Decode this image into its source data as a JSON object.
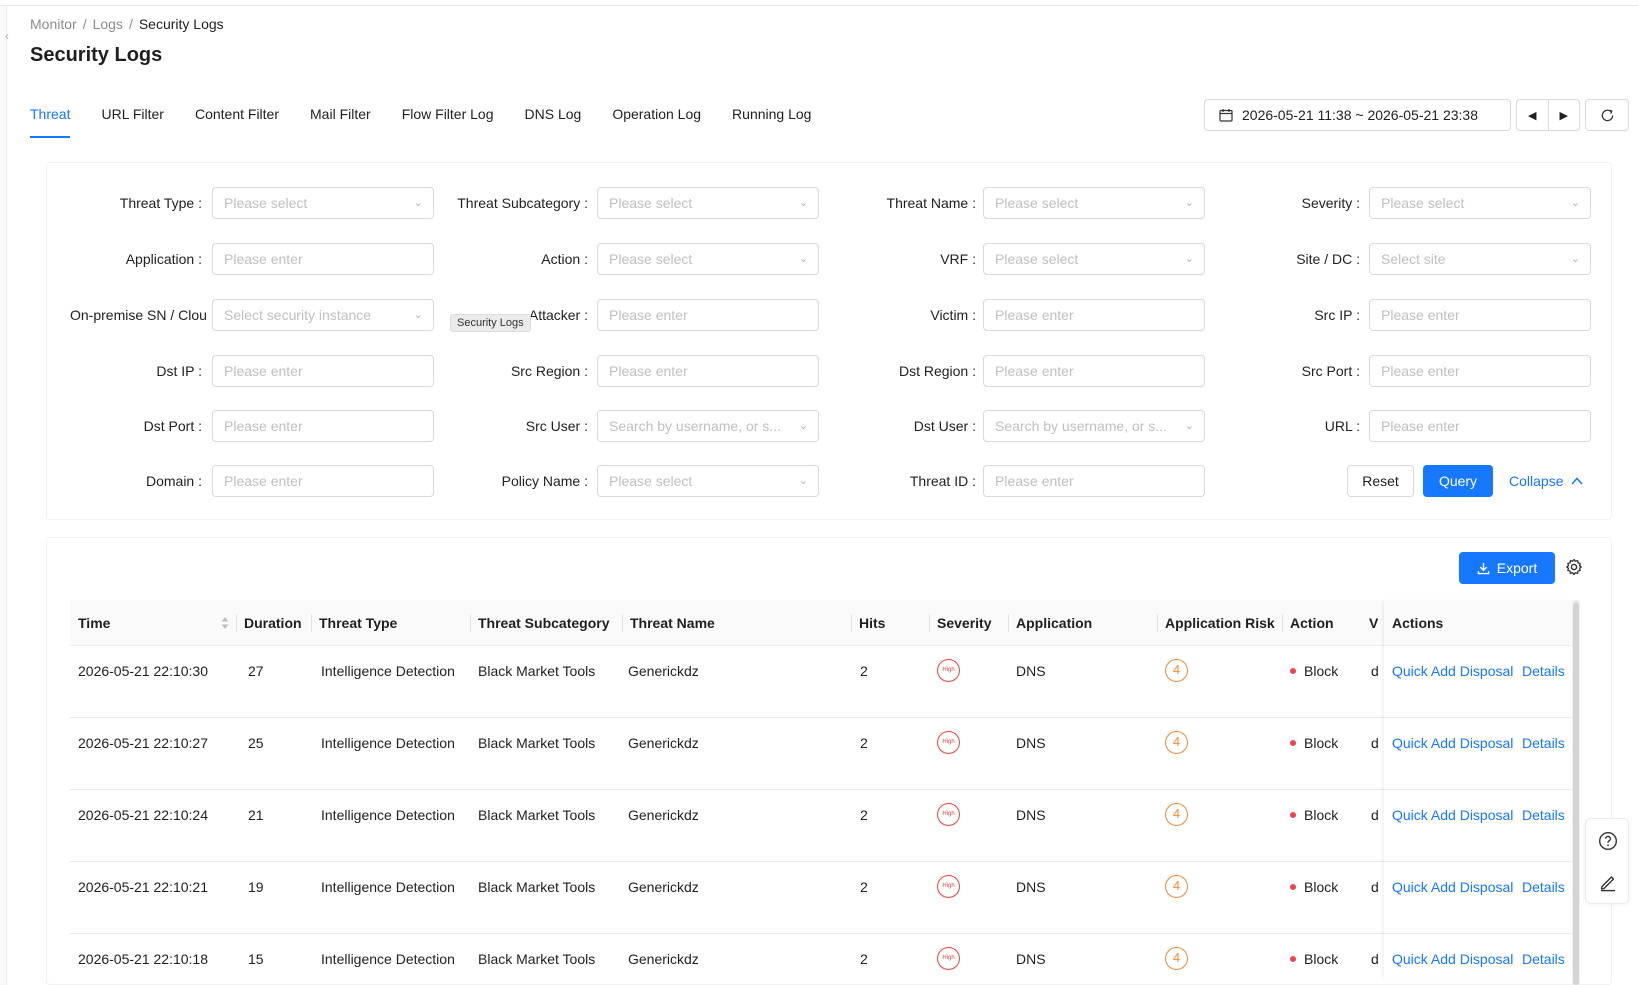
{
  "breadcrumb": [
    "Monitor",
    "Logs",
    "Security Logs"
  ],
  "page_title": "Security Logs",
  "tabs": [
    "Threat",
    "URL Filter",
    "Content Filter",
    "Mail Filter",
    "Flow Filter Log",
    "DNS Log",
    "Operation Log",
    "Running Log"
  ],
  "active_tab": "Threat",
  "date_range": "2026-05-21 11:38 ~ 2026-05-21 23:38",
  "tooltip": "Security Logs",
  "filters": [
    {
      "label": "Threat Type",
      "placeholder": "Please select",
      "kind": "select"
    },
    {
      "label": "Threat Subcategory",
      "placeholder": "Please select",
      "kind": "select"
    },
    {
      "label": "Threat Name",
      "placeholder": "Please select",
      "kind": "select"
    },
    {
      "label": "Severity",
      "placeholder": "Please select",
      "kind": "select"
    },
    {
      "label": "Application",
      "placeholder": "Please enter",
      "kind": "input"
    },
    {
      "label": "Action",
      "placeholder": "Please select",
      "kind": "select"
    },
    {
      "label": "VRF",
      "placeholder": "Please select",
      "kind": "select"
    },
    {
      "label": "Site / DC",
      "placeholder": "Select site",
      "kind": "select"
    },
    {
      "label": "On-premise SN / Clou",
      "placeholder": "Select security instance",
      "kind": "select"
    },
    {
      "label": "Attacker",
      "placeholder": "Please enter",
      "kind": "input"
    },
    {
      "label": "Victim",
      "placeholder": "Please enter",
      "kind": "input"
    },
    {
      "label": "Src IP",
      "placeholder": "Please enter",
      "kind": "input"
    },
    {
      "label": "Dst IP",
      "placeholder": "Please enter",
      "kind": "input"
    },
    {
      "label": "Src Region",
      "placeholder": "Please enter",
      "kind": "input"
    },
    {
      "label": "Dst Region",
      "placeholder": "Please enter",
      "kind": "input"
    },
    {
      "label": "Src Port",
      "placeholder": "Please enter",
      "kind": "input"
    },
    {
      "label": "Dst Port",
      "placeholder": "Please enter",
      "kind": "input"
    },
    {
      "label": "Src User",
      "placeholder": "Search by username, or s...",
      "kind": "select"
    },
    {
      "label": "Dst User",
      "placeholder": "Search by username, or s...",
      "kind": "select"
    },
    {
      "label": "URL",
      "placeholder": "Please enter",
      "kind": "input"
    },
    {
      "label": "Domain",
      "placeholder": "Please enter",
      "kind": "input"
    },
    {
      "label": "Policy Name",
      "placeholder": "Please select",
      "kind": "select"
    },
    {
      "label": "Threat ID",
      "placeholder": "Please enter",
      "kind": "input"
    }
  ],
  "buttons": {
    "reset": "Reset",
    "query": "Query",
    "collapse": "Collapse",
    "export": "Export"
  },
  "table": {
    "columns": [
      "Time",
      "Duration",
      "Threat Type",
      "Threat Subcategory",
      "Threat Name",
      "Hits",
      "Severity",
      "Application",
      "Application Risk",
      "Action",
      "V",
      "Actions"
    ],
    "rows": [
      {
        "time": "2026-05-21 22:10:30",
        "duration": "27",
        "threat_type": "Intelligence Detection",
        "subcategory": "Black Market Tools",
        "threat_name": "Generickdz",
        "hits": "2",
        "severity": "High",
        "application": "DNS",
        "app_risk": "4",
        "action": "Block",
        "v": "d",
        "quick_add": "Quick Add Disposal",
        "details": "Details"
      },
      {
        "time": "2026-05-21 22:10:27",
        "duration": "25",
        "threat_type": "Intelligence Detection",
        "subcategory": "Black Market Tools",
        "threat_name": "Generickdz",
        "hits": "2",
        "severity": "High",
        "application": "DNS",
        "app_risk": "4",
        "action": "Block",
        "v": "d",
        "quick_add": "Quick Add Disposal",
        "details": "Details"
      },
      {
        "time": "2026-05-21 22:10:24",
        "duration": "21",
        "threat_type": "Intelligence Detection",
        "subcategory": "Black Market Tools",
        "threat_name": "Generickdz",
        "hits": "2",
        "severity": "High",
        "application": "DNS",
        "app_risk": "4",
        "action": "Block",
        "v": "d",
        "quick_add": "Quick Add Disposal",
        "details": "Details"
      },
      {
        "time": "2026-05-21 22:10:21",
        "duration": "19",
        "threat_type": "Intelligence Detection",
        "subcategory": "Black Market Tools",
        "threat_name": "Generickdz",
        "hits": "2",
        "severity": "High",
        "application": "DNS",
        "app_risk": "4",
        "action": "Block",
        "v": "d",
        "quick_add": "Quick Add Disposal",
        "details": "Details"
      },
      {
        "time": "2026-05-21 22:10:18",
        "duration": "15",
        "threat_type": "Intelligence Detection",
        "subcategory": "Black Market Tools",
        "threat_name": "Generickdz",
        "hits": "2",
        "severity": "High",
        "application": "DNS",
        "app_risk": "4",
        "action": "Block",
        "v": "d",
        "quick_add": "Quick Add Disposal",
        "details": "Details"
      }
    ]
  },
  "colors": {
    "primary": "#1677ff",
    "severity_high": "#e8433f",
    "risk": "#f08a3c",
    "block_dot": "#f04545"
  },
  "icons": [
    "calendar-icon",
    "caret-left-icon",
    "caret-right-icon",
    "refresh-icon",
    "chevron-down-icon",
    "chevron-up-icon",
    "download-icon",
    "gear-icon",
    "sort-icon",
    "help-icon",
    "edit-icon",
    "collapse-sidebar-icon"
  ]
}
